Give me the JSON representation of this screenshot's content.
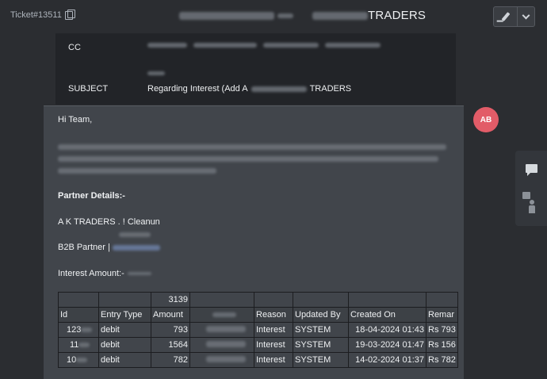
{
  "topbar": {
    "ticket_label": "Ticket#13511",
    "title_suffix": "TRADERS"
  },
  "header": {
    "cc_label": "CC",
    "subject_label": "SUBJECT",
    "subject_prefix": "Regarding Interest (Add A",
    "subject_suffix": "TRADERS"
  },
  "avatar": {
    "initials": "AB",
    "color": "#e25c68"
  },
  "message": {
    "greeting": "Hi Team,",
    "partner_heading": "Partner Details:-",
    "partner_name": "A K TRADERS . ! Cleanun",
    "partner_type": "B2B Partner |",
    "interest_label": "Interest Amount:-"
  },
  "table": {
    "summary_amount": "3139",
    "columns": [
      "Id",
      "Entry Type",
      "Amount",
      "",
      "Reason",
      "Updated By",
      "Created On",
      "Remar"
    ],
    "rows": [
      {
        "id": "123",
        "entry_type": "debit",
        "amount": "793",
        "reason": "Interest",
        "updated_by": "SYSTEM",
        "created_on": "18-04-2024 01:43",
        "remark": "Rs 793"
      },
      {
        "id": "11",
        "entry_type": "debit",
        "amount": "1564",
        "reason": "Interest",
        "updated_by": "SYSTEM",
        "created_on": "19-03-2024 01:47",
        "remark": "Rs 156"
      },
      {
        "id": "10",
        "entry_type": "debit",
        "amount": "782",
        "reason": "Interest",
        "updated_by": "SYSTEM",
        "created_on": "14-02-2024 01:37",
        "remark": "Rs 782"
      }
    ]
  },
  "icons": {
    "copy": "copy-icon",
    "edit": "pen-icon",
    "menu": "chevron-down-icon",
    "chat": "chat-icon",
    "contact": "person-icon"
  }
}
